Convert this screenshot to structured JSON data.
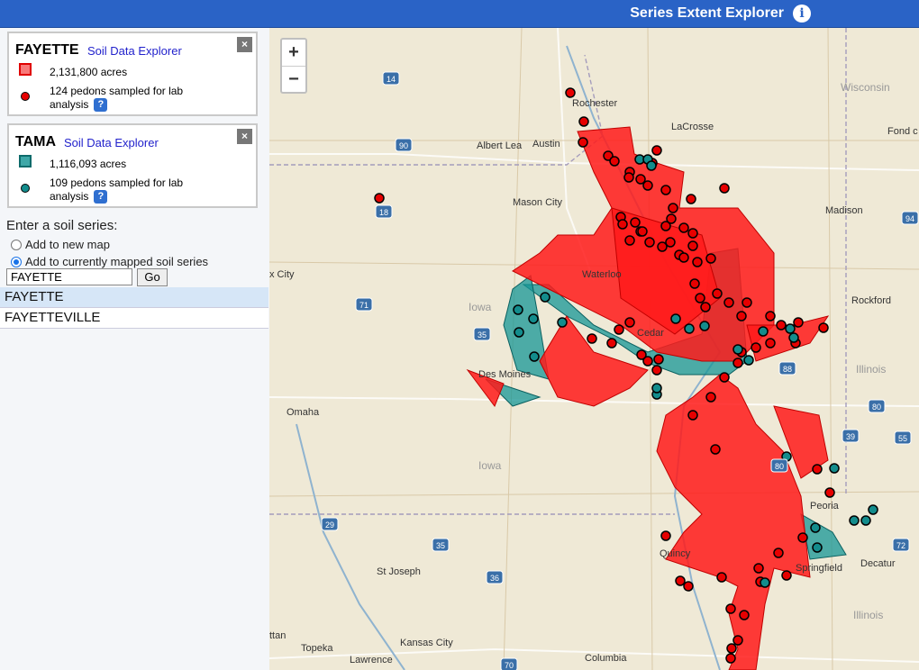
{
  "app": {
    "title": "Series Extent Explorer",
    "info_icon": "info-icon"
  },
  "series_cards": [
    {
      "name": "FAYETTE",
      "link": "Soil Data Explorer",
      "acres": "2,131,800 acres",
      "pedons": "124 pedons sampled for lab analysis",
      "color": "#ff1a1a"
    },
    {
      "name": "TAMA",
      "link": "Soil Data Explorer",
      "acres": "1,116,093 acres",
      "pedons": "109 pedons sampled for lab analysis",
      "color": "#159596"
    }
  ],
  "close_label": "×",
  "help_label": "?",
  "search": {
    "label": "Enter a soil series:",
    "option_new": "Add to new map",
    "option_current": "Add to currently mapped soil series",
    "selected_option": "Add to currently mapped soil series",
    "value": "FAYETTE",
    "go_label": "Go",
    "suggestions": [
      "FAYETTE",
      "FAYETTEVILLE"
    ]
  },
  "map": {
    "zoom_in": "+",
    "zoom_out": "−",
    "labels": {
      "rochester": "Rochester",
      "lacrosse": "LaCrosse",
      "albert_lea": "Albert Lea",
      "austin": "Austin",
      "mason_city": "Mason City",
      "wisconsin": "Wisconsin",
      "fond": "Fond c",
      "madison": "Madison",
      "rockford": "Rockford",
      "waterloo": "Waterloo",
      "x_city": "x City",
      "iowa1": "Iowa",
      "cedar": "Cedar",
      "des_moines": "Des Moines",
      "illinois1": "Illinois",
      "omaha": "Omaha",
      "iowa2": "Iowa",
      "peoria": "Peoria",
      "quincy": "Quincy",
      "decatur": "Decatur",
      "springfield": "Springfield",
      "st_joseph": "St Joseph",
      "illinois2": "Illinois",
      "topeka": "Topeka",
      "kansas_city": "Kansas City",
      "lawrence": "Lawrence",
      "columbia": "Columbia",
      "ttan": "ttan"
    },
    "shields": {
      "i14": "14",
      "i90": "90",
      "i18": "18",
      "i94": "94",
      "i71": "71",
      "i35a": "35",
      "i88": "88",
      "i80a": "80",
      "i80b": "80",
      "i55": "55",
      "i39": "39",
      "i29": "29",
      "i35b": "35",
      "i36": "36",
      "i72": "72",
      "i70": "70"
    },
    "soil_colors": {
      "fayette": "#ff1a1a",
      "tama": "#159596",
      "pedon_fayette": "#e60000",
      "pedon_tama": "#138c8c"
    }
  }
}
